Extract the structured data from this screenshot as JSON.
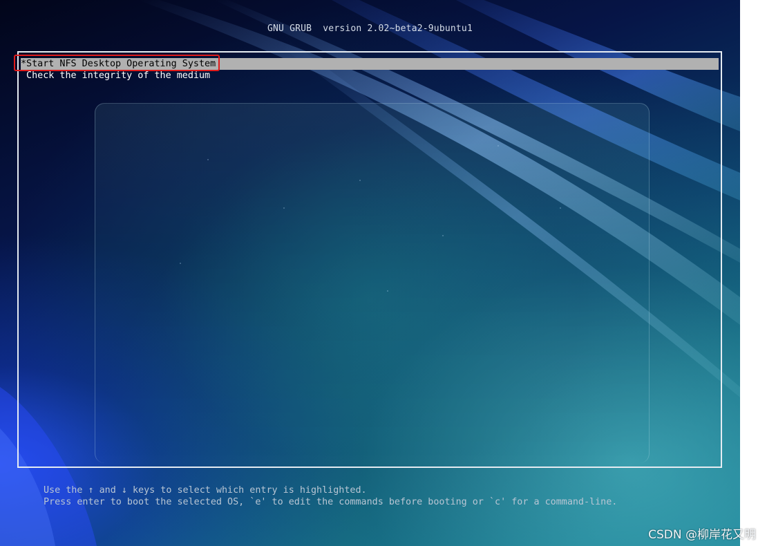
{
  "header": {
    "title": "GNU GRUB  version 2.02~beta2-9ubuntu1"
  },
  "menu": {
    "items": [
      {
        "label": "*Start NFS Desktop Operating System",
        "selected": true
      },
      {
        "label": " Check the integrity of the medium",
        "selected": false
      }
    ]
  },
  "help": {
    "line1": "Use the ↑ and ↓ keys to select which entry is highlighted.",
    "line2": "Press enter to boot the selected OS, `e' to edit the commands before booting or `c' for a command-line."
  },
  "watermark": "CSDN @柳岸花又明",
  "colors": {
    "selection_bg": "#b1b1b1",
    "frame_border": "#e6ecf2",
    "annotation_box": "#e01a1a"
  }
}
